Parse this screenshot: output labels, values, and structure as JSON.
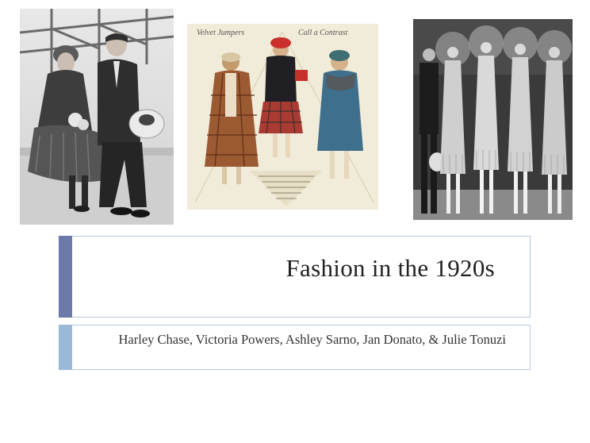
{
  "slide": {
    "title": "Fashion in the 1920s",
    "authors": "Harley Chase, Victoria Powers, Ashley Sarno, Jan Donato, & Julie Tonuzi",
    "colors": {
      "title_accent": "#6b7aa8",
      "subtitle_accent": "#9ab9d6",
      "border": "#b9c6d8"
    }
  },
  "images": {
    "center_caption_left": "Velvet Jumpers",
    "center_caption_right": "Call a Contrast"
  }
}
